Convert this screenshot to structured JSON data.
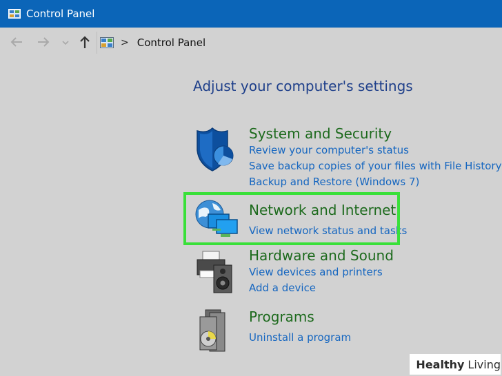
{
  "window": {
    "title": "Control Panel"
  },
  "address_bar": {
    "breadcrumb": "Control Panel",
    "separator": ">"
  },
  "heading": "Adjust your computer's settings",
  "categories": [
    {
      "title": "System and Security",
      "icon": "shield-icon",
      "links": [
        "Review your computer's status",
        "Save backup copies of your files with File History",
        "Backup and Restore (Windows 7)"
      ]
    },
    {
      "title": "Network and Internet",
      "icon": "network-globe-icon",
      "links": [
        "View network status and tasks"
      ]
    },
    {
      "title": "Hardware and Sound",
      "icon": "printer-speaker-icon",
      "links": [
        "View devices and printers",
        "Add a device"
      ]
    },
    {
      "title": "Programs",
      "icon": "programs-disc-icon",
      "links": [
        "Uninstall a program"
      ]
    }
  ],
  "watermark": {
    "word1": "Healthy",
    "word2": "Living"
  },
  "colors": {
    "titlebar": "#0b65b8",
    "background": "#d2d2d2",
    "category_title": "#1d6a1d",
    "link": "#1566c0",
    "highlight": "#39e039"
  }
}
